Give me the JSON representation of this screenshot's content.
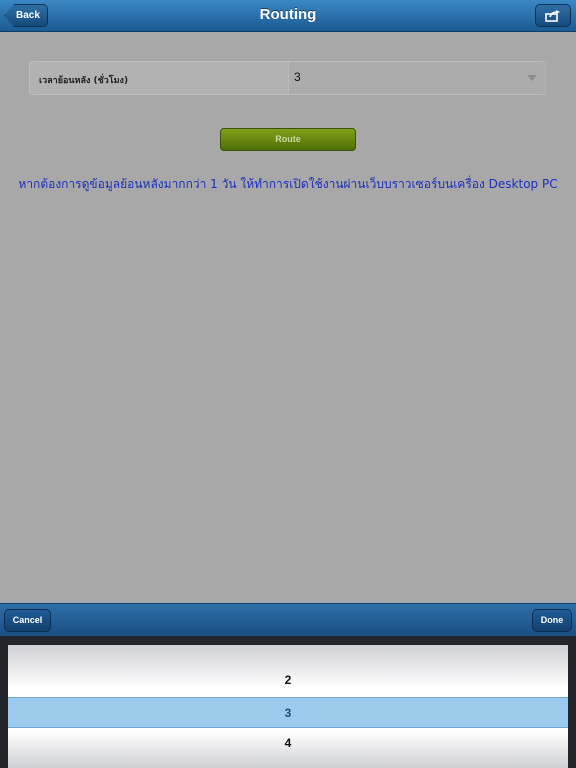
{
  "navbar": {
    "title": "Routing",
    "back_label": "Back",
    "share_icon": "share-icon"
  },
  "form": {
    "label": "เวลาย้อนหลัง (ชั่วโมง)",
    "selected_value": "3"
  },
  "route_button": "Route",
  "notice": "หากต้องการดูข้อมูลย้อนหลังมากกว่า 1 วัน ให้ทำการเปิดใช้งานผ่านเว็บบราวเซอร์บนเครื่อง Desktop PC",
  "picker": {
    "cancel_label": "Cancel",
    "done_label": "Done",
    "options": [
      "2",
      "3",
      "4"
    ],
    "selected": "3"
  },
  "colors": {
    "navbar": "#1c5a93",
    "route_button": "#5f8510",
    "notice_text": "#1a2fbf",
    "selection": "#9ccbee"
  }
}
